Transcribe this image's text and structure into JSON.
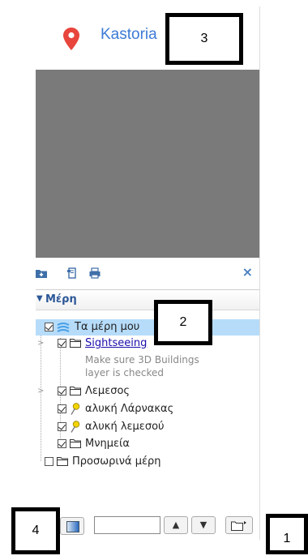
{
  "search": {
    "place_name": "Kastoria"
  },
  "toolbar": {
    "close_symbol": "×"
  },
  "places": {
    "header": "Μέρη",
    "items": [
      {
        "label": "Τα μέρη μου",
        "checked": true,
        "icon": "my-places-globe-icon"
      },
      {
        "label": "Sightseeing",
        "checked": true,
        "icon": "folder-icon",
        "note_line1": "Make sure 3D Buildings",
        "note_line2": "layer is checked"
      },
      {
        "label": "Λεμεσος",
        "checked": true,
        "icon": "folder-icon"
      },
      {
        "label": "αλυκή Λάρνακας",
        "checked": true,
        "icon": "yellow-pushpin-icon"
      },
      {
        "label": "αλυκή λεμεσού",
        "checked": true,
        "icon": "yellow-pushpin-icon"
      },
      {
        "label": "Μνημεία",
        "checked": true,
        "icon": "folder-icon"
      },
      {
        "label": "Προσωρινά μέρη",
        "checked": false,
        "icon": "folder-icon"
      }
    ]
  },
  "callouts": {
    "one": "1",
    "two": "2",
    "three": "3",
    "four": "4"
  },
  "colors": {
    "accent": "#3d7bd6",
    "selection": "#b6dcfa",
    "map_gray": "#7a7a7a",
    "header_text": "#2b5797"
  }
}
